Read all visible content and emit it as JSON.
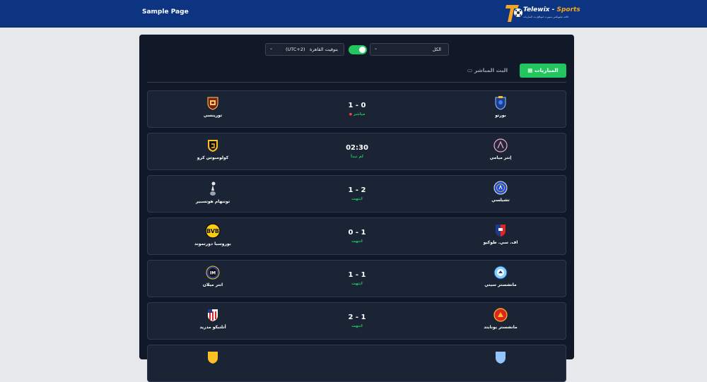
{
  "header": {
    "page_link": "Sample Page",
    "logo_title_white": "Telewix - ",
    "logo_title_orange": "Sports",
    "logo_tagline": "قالب تيليويكس سبورت لمواقع بث المباريات",
    "colors": {
      "bar": "#0d3480",
      "accent": "#f5a623"
    }
  },
  "filters": {
    "league_select": "الكل",
    "timezone_select": "(UTC+2)",
    "timezone_label": "بتوقيت القاهرة",
    "toggle_on": true
  },
  "tabs": {
    "matches": "المباريات",
    "live": "البث المباشر"
  },
  "matches": [
    {
      "home": "بورتو",
      "away": "تورينسي",
      "score": "1 - 0",
      "status": "مباشر",
      "live": true,
      "home_icon": "porto-crest-icon",
      "away_icon": "torreense-crest-icon"
    },
    {
      "home": "إنتر ميامي",
      "away": "كولومبوس كرو",
      "score": "02:30",
      "status": "لم تبدأ",
      "live": false,
      "home_icon": "inter-miami-crest-icon",
      "away_icon": "columbus-crew-crest-icon"
    },
    {
      "home": "تشيلسي",
      "away": "توتنهام هوتسبير",
      "score": "1 - 2",
      "status": "انتهت",
      "live": false,
      "home_icon": "chelsea-crest-icon",
      "away_icon": "tottenham-crest-icon"
    },
    {
      "home": "اف. سي. طوكيو",
      "away": "بوروسيا دورتموند",
      "score": "0 - 1",
      "status": "انتهت",
      "live": false,
      "home_icon": "fc-tokyo-crest-icon",
      "away_icon": "dortmund-crest-icon"
    },
    {
      "home": "مانشستر سيتي",
      "away": "انتر ميلان",
      "score": "1 - 1",
      "status": "انتهت",
      "live": false,
      "home_icon": "man-city-crest-icon",
      "away_icon": "inter-milan-crest-icon"
    },
    {
      "home": "مانشستر يونايتد",
      "away": "أتلتيكو مدريد",
      "score": "2 - 1",
      "status": "انتهت",
      "live": false,
      "home_icon": "man-united-crest-icon",
      "away_icon": "atletico-crest-icon"
    }
  ]
}
